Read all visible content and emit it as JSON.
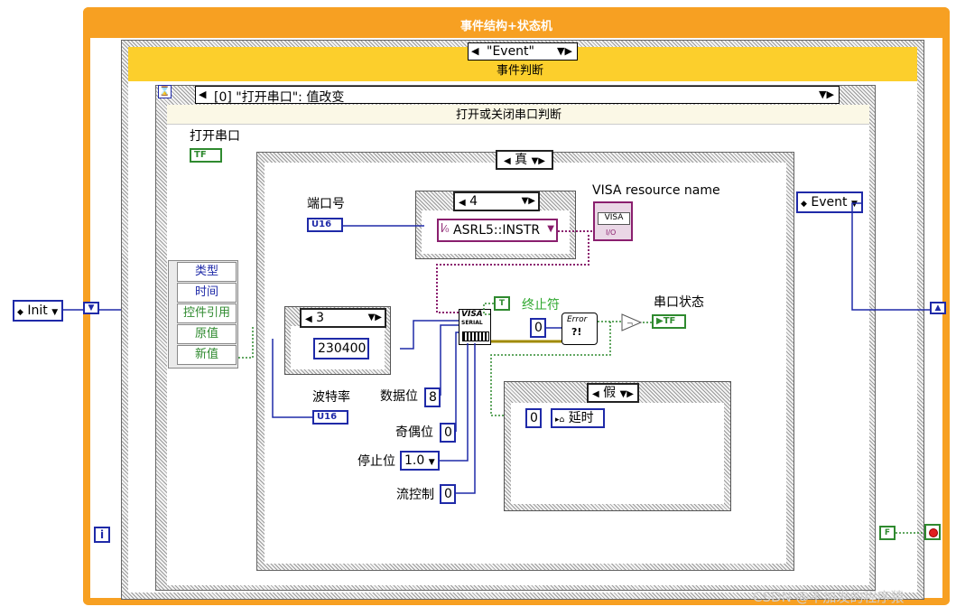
{
  "window": {
    "title": "事件结构+状态机"
  },
  "outer_case": {
    "selector": "\"Event\"",
    "subtitle": "事件判断"
  },
  "event_case": {
    "selector": "[0] \"打开串口\": 值改变",
    "subtitle": "打开或关闭串口判断"
  },
  "open_port": {
    "label": "打开串口",
    "indicator": "TF"
  },
  "event_data_node": {
    "items": [
      "类型",
      "时间",
      "控件引用",
      "原值",
      "新值"
    ]
  },
  "bool_case": {
    "true_label": "真",
    "false_label": "假"
  },
  "port_section": {
    "label": "端口号",
    "type_tag": "U16",
    "case_selector": "4",
    "resource_value": "ASRL5::INSTR",
    "visa_label": "VISA resource name",
    "visa_icon": "VISA",
    "visa_sub": "I/O"
  },
  "baud_section": {
    "case_selector": "3",
    "value": "230400",
    "label": "波特率",
    "type_tag": "U16"
  },
  "serial_config": {
    "icon_line1": "VISA",
    "icon_line2": "SERIAL",
    "term_char_label": "终止符",
    "term_char_const": "T",
    "data_bits_label": "数据位",
    "data_bits_value": "8",
    "parity_label": "奇偶位",
    "parity_value": "0",
    "stop_bits_label": "停止位",
    "stop_bits_value": "1.0",
    "flow_label": "流控制",
    "flow_value": "0"
  },
  "error_section": {
    "zero_const": "0",
    "error_icon_line1": "Error",
    "error_icon_line2": "?!",
    "status_label": "串口状态",
    "status_indicator": "TF"
  },
  "false_case": {
    "zero_const": "0",
    "enum_value": "延时"
  },
  "right_side": {
    "event_enum": "Event",
    "false_const": "F"
  },
  "left_side": {
    "init_enum": "Init",
    "iteration_label": "i"
  },
  "watermark": "CSDN @不加发的程序猿",
  "colors": {
    "loop_border": "#f7a022",
    "case_header": "#fccf2c",
    "wire_blue": "#1f2aa8",
    "wire_purple": "#8a1f6e",
    "bool_green": "#2f8a2f"
  }
}
